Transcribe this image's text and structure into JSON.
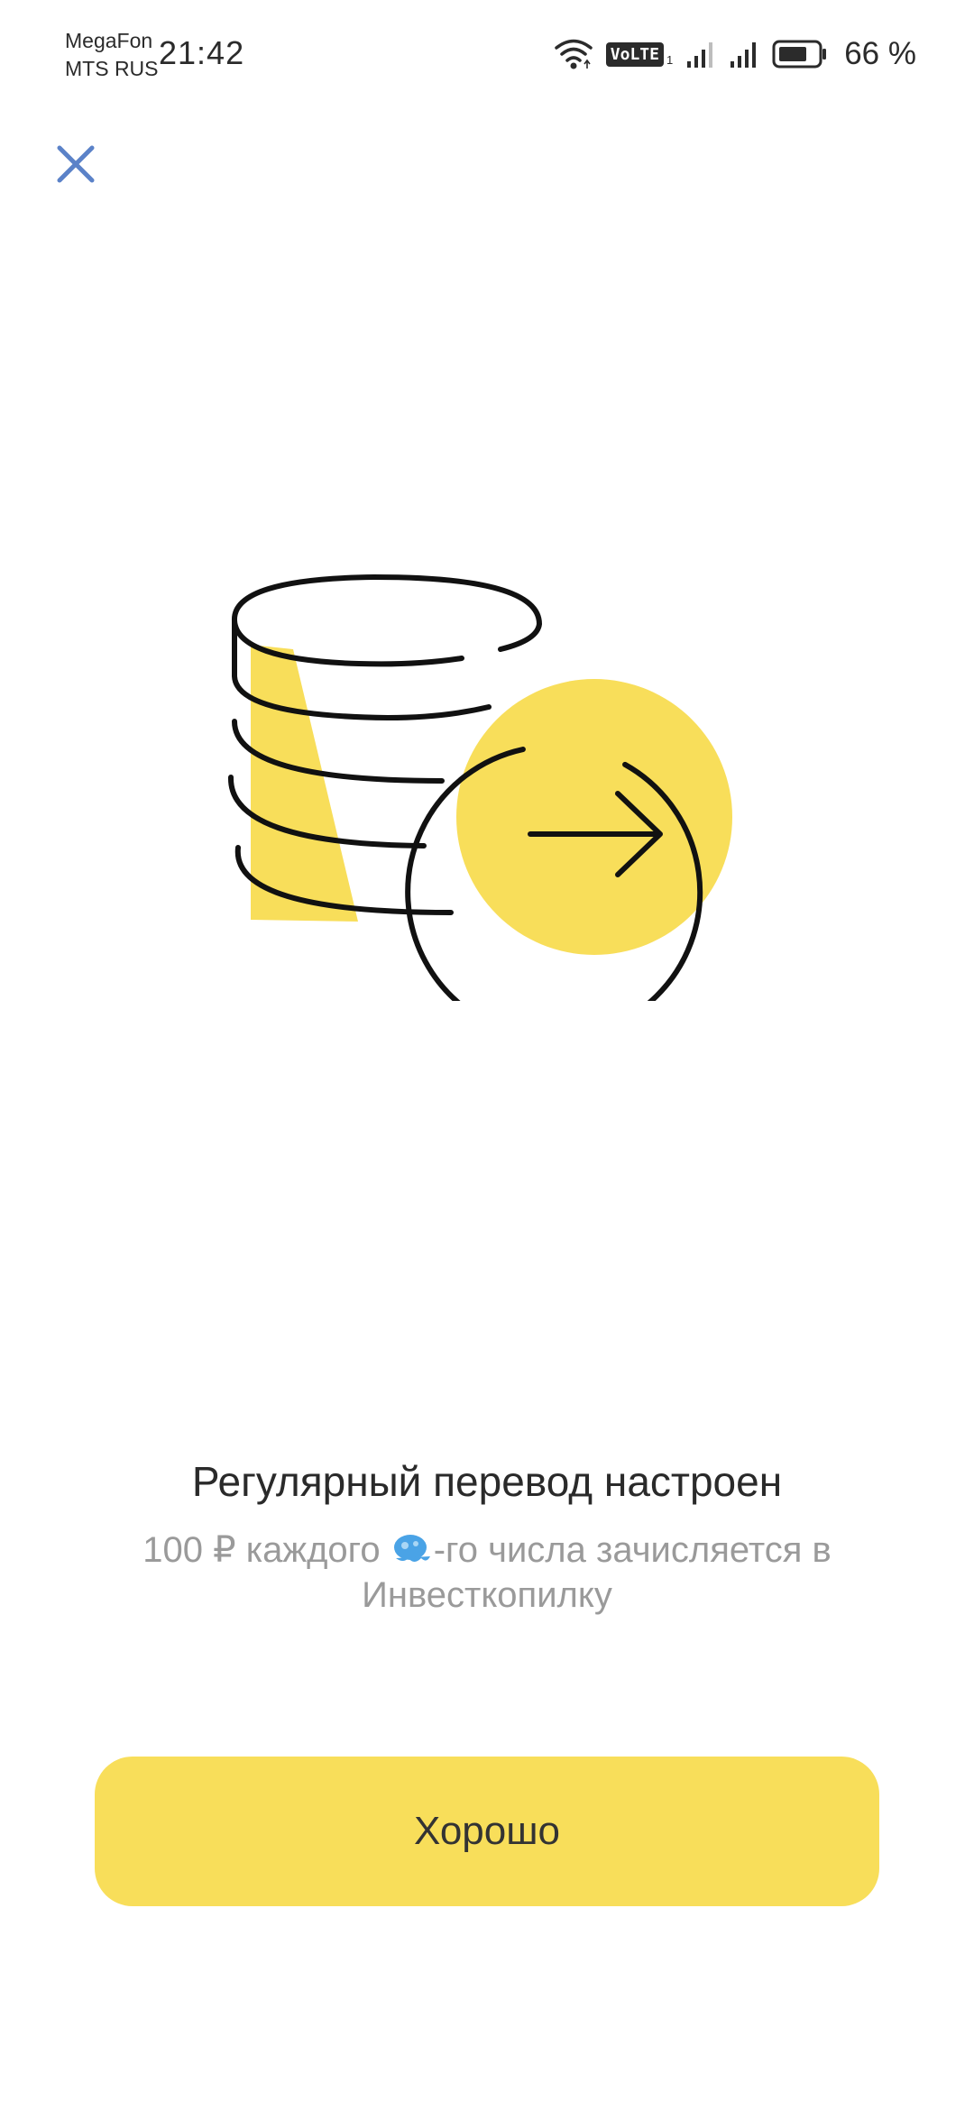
{
  "status_bar": {
    "carrier_1": "MegaFon",
    "carrier_2": "MTS RUS",
    "time": "21:42",
    "volte_label": "VoLTE",
    "battery_percent": "66 %",
    "icons": [
      "wifi-icon",
      "volte-icon",
      "signal-icon",
      "signal-icon",
      "battery-icon"
    ]
  },
  "header": {
    "close_icon": "close-icon"
  },
  "illustration": {
    "icon": "coins-transfer-icon",
    "accent_color": "#f8de5a"
  },
  "message": {
    "title": "Регулярный перевод настроен",
    "subtitle_prefix": "100 ₽ каждого ",
    "subtitle_emoji_icon": "placeholder-emoji-icon",
    "subtitle_suffix": "-го числа зачисляется в Инвесткопилку"
  },
  "actions": {
    "ok_label": "Хорошо"
  },
  "colors": {
    "accent": "#f8de5a",
    "close_icon": "#5b82c8",
    "subtitle_text": "#9a9a9a"
  }
}
